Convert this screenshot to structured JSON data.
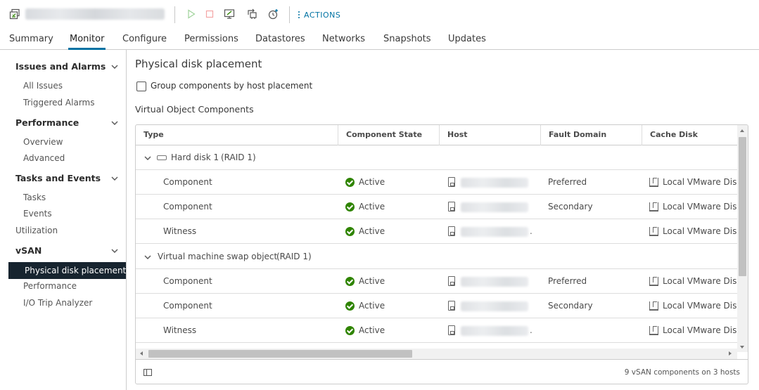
{
  "toolbar": {
    "actions_label": "ACTIONS",
    "icons": [
      "vm-icon",
      "power-on-icon",
      "power-off-icon",
      "console-icon",
      "migrate-icon",
      "snapshot-icon"
    ],
    "colors": {
      "accent": "#0072a3",
      "disabled_play": "#9fd39a",
      "disabled_stop": "#f4a5a5"
    }
  },
  "tabs": [
    {
      "label": "Summary"
    },
    {
      "label": "Monitor",
      "active": true
    },
    {
      "label": "Configure"
    },
    {
      "label": "Permissions"
    },
    {
      "label": "Datastores"
    },
    {
      "label": "Networks"
    },
    {
      "label": "Snapshots"
    },
    {
      "label": "Updates"
    }
  ],
  "sidebar": {
    "sections": [
      {
        "label": "Issues and Alarms",
        "items": [
          "All Issues",
          "Triggered Alarms"
        ]
      },
      {
        "label": "Performance",
        "items": [
          "Overview",
          "Advanced"
        ]
      },
      {
        "label": "Tasks and Events",
        "items": [
          "Tasks",
          "Events"
        ]
      },
      {
        "label": "vSAN",
        "items": [
          "Physical disk placement",
          "Performance",
          "I/O Trip Analyzer"
        ]
      }
    ],
    "utilization": "Utilization",
    "selected": "Physical disk placement"
  },
  "main": {
    "title": "Physical disk placement",
    "group_checkbox_label": "Group components by host placement",
    "group_checked": false,
    "section_title": "Virtual Object Components",
    "columns": [
      "Type",
      "Component State",
      "Host",
      "Fault Domain",
      "Cache Disk"
    ],
    "groups": [
      {
        "name": "Hard disk 1",
        "raid": "(RAID 1)",
        "rows": [
          {
            "type": "Component",
            "state": "Active",
            "fault_domain": "Preferred",
            "cache_disk": "Local VMware Disk"
          },
          {
            "type": "Component",
            "state": "Active",
            "fault_domain": "Secondary",
            "cache_disk": "Local VMware Disk"
          },
          {
            "type": "Witness",
            "state": "Active",
            "fault_domain": "",
            "cache_disk": "Local VMware Disk"
          }
        ]
      },
      {
        "name": "Virtual machine swap object",
        "raid": "(RAID 1)",
        "rows": [
          {
            "type": "Component",
            "state": "Active",
            "fault_domain": "Preferred",
            "cache_disk": "Local VMware Disk"
          },
          {
            "type": "Component",
            "state": "Active",
            "fault_domain": "Secondary",
            "cache_disk": "Local VMware Disk"
          },
          {
            "type": "Witness",
            "state": "Active",
            "fault_domain": "",
            "cache_disk": "Local VMware Disk"
          }
        ]
      }
    ],
    "footer_count": "9 vSAN components on 3 hosts",
    "status_color": "#2f8400"
  }
}
